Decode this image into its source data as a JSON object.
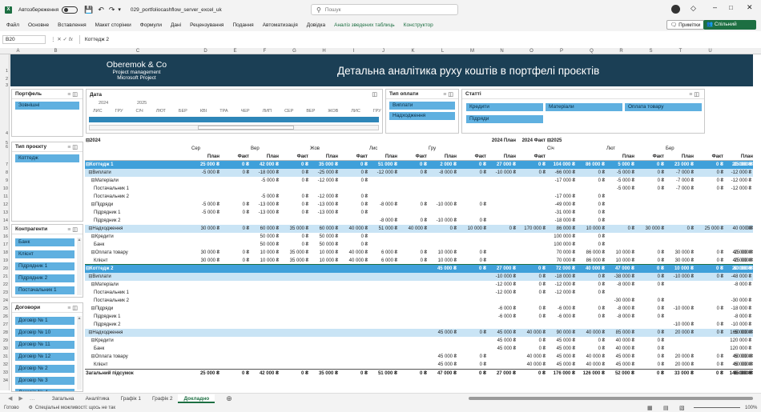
{
  "app": {
    "autosave_label": "Автозбереження",
    "file_name": "029_portfoliocashflow_server_excel_uk",
    "search_placeholder": "Пошук"
  },
  "menu": {
    "items": [
      "Файл",
      "Основне",
      "Вставлення",
      "Макет сторінки",
      "Формули",
      "Дані",
      "Рецензування",
      "Подання",
      "Автоматизація",
      "Довідка",
      "Аналіз зведених таблиць",
      "Конструктор"
    ],
    "notes": "Примітки",
    "share": "Спільний доступ"
  },
  "formula": {
    "cell_ref": "B20",
    "fx": "fx",
    "value": "Коттедж 2"
  },
  "columns": [
    "A",
    "B",
    "C",
    "D",
    "E",
    "F",
    "G",
    "H",
    "I",
    "J",
    "K",
    "L",
    "M",
    "N",
    "O",
    "P",
    "Q",
    "R",
    "S",
    "T",
    "U"
  ],
  "brand": {
    "name": "Oberemok & Co",
    "line1": "Project management",
    "line2": "Microsoft Project"
  },
  "report_title": "Детальна аналітика руху коштів в портфелі проєктів",
  "slicers": {
    "portfel": {
      "title": "Портфель",
      "items": [
        "Зовнішні"
      ]
    },
    "date": {
      "title": "Дата",
      "years": [
        "2024",
        "2025"
      ],
      "months": [
        "ЛИС",
        "ГРУ",
        "СІЧ",
        "ЛЮТ",
        "БЕР",
        "КВІ",
        "ТРА",
        "ЧЕР",
        "ЛИП",
        "СЕР",
        "ВЕР",
        "ЖОВ",
        "ЛИС",
        "ГРУ"
      ]
    },
    "pay_type": {
      "title": "Тип оплати",
      "items": [
        "Виплати",
        "Надходження"
      ]
    },
    "articles": {
      "title": "Статті",
      "items": [
        "Кредити",
        "Матеріали",
        "Оплата товару",
        "Підряди"
      ]
    },
    "project_type": {
      "title": "Тип проєкту",
      "items": [
        "Коттедж"
      ]
    },
    "contractors": {
      "title": "Контрагенти",
      "items": [
        "Банк",
        "Клієнт",
        "Підрядник 1",
        "Підрядник 2",
        "Постачальник 1"
      ]
    },
    "contracts": {
      "title": "Договори",
      "items": [
        "Договір № 1",
        "Договір № 10",
        "Договір № 11",
        "Договір № 12",
        "Договір № 2",
        "Договір № 3",
        "Договір № 4"
      ]
    }
  },
  "pivot": {
    "year_row": [
      "⊟2024",
      "2024 План",
      "2024 Факт",
      "⊟2025",
      "2025 План"
    ],
    "months": [
      "Сер",
      "Вер",
      "Жов",
      "Лис",
      "Гру",
      "Січ",
      "Лют",
      "Бер"
    ],
    "plan": "План",
    "fact": "Факт",
    "rows": [
      [
        "⊟Коттедж 1",
        "25 000 ₴",
        "0 ₴",
        "42 000 ₴",
        "0 ₴",
        "35 000 ₴",
        "0 ₴",
        "51 000 ₴",
        "0 ₴",
        "2 000 ₴",
        "0 ₴",
        "27 000 ₴",
        "0 ₴",
        "104 000 ₴",
        "86 000 ₴",
        "5 000 ₴",
        "0 ₴",
        "23 000 ₴",
        "0 ₴",
        "25 000 ₴",
        "0 ₴",
        "",
        "20 000 ₴"
      ],
      [
        "  ⊟Виплати",
        "-5 000 ₴",
        "0 ₴",
        "-18 000 ₴",
        "0 ₴",
        "-25 000 ₴",
        "0 ₴",
        "-12 000 ₴",
        "0 ₴",
        "-8 000 ₴",
        "0 ₴",
        "-10 000 ₴",
        "0 ₴",
        "-66 000 ₴",
        "0 ₴",
        "-5 000 ₴",
        "0 ₴",
        "-7 000 ₴",
        "0 ₴",
        "",
        "",
        "",
        "-12 000 ₴"
      ],
      [
        "    ⊟Матеріали",
        "",
        "",
        "-5 000 ₴",
        "0 ₴",
        "-12 000 ₴",
        "0 ₴",
        "",
        "",
        "",
        "",
        "",
        "",
        "-17 000 ₴",
        "0 ₴",
        "-5 000 ₴",
        "0 ₴",
        "-7 000 ₴",
        "0 ₴",
        "",
        "",
        "",
        "-12 000 ₴"
      ],
      [
        "      Постачальник 1",
        "",
        "",
        "",
        "",
        "",
        "",
        "",
        "",
        "",
        "",
        "",
        "",
        "",
        "",
        "-5 000 ₴",
        "0 ₴",
        "-7 000 ₴",
        "0 ₴",
        "",
        "",
        "",
        "-12 000 ₴"
      ],
      [
        "      Постачальник 2",
        "",
        "",
        "-5 000 ₴",
        "0 ₴",
        "-12 000 ₴",
        "0 ₴",
        "",
        "",
        "",
        "",
        "",
        "",
        "-17 000 ₴",
        "0 ₴",
        "",
        "",
        "",
        "",
        "",
        "",
        "",
        ""
      ],
      [
        "    ⊟Підряди",
        "-5 000 ₴",
        "0 ₴",
        "-13 000 ₴",
        "0 ₴",
        "-13 000 ₴",
        "0 ₴",
        "-8 000 ₴",
        "0 ₴",
        "-10 000 ₴",
        "0 ₴",
        "",
        "",
        "-49 000 ₴",
        "0 ₴",
        "",
        "",
        "",
        "",
        "",
        "",
        "",
        ""
      ],
      [
        "      Підрядник 1",
        "-5 000 ₴",
        "0 ₴",
        "-13 000 ₴",
        "0 ₴",
        "-13 000 ₴",
        "0 ₴",
        "",
        "",
        "",
        "",
        "",
        "",
        "-31 000 ₴",
        "0 ₴",
        "",
        "",
        "",
        "",
        "",
        "",
        "",
        ""
      ],
      [
        "      Підрядник 2",
        "",
        "",
        "",
        "",
        "",
        "",
        "-8 000 ₴",
        "0 ₴",
        "-10 000 ₴",
        "0 ₴",
        "",
        "",
        "-18 000 ₴",
        "0 ₴",
        "",
        "",
        "",
        "",
        "",
        "",
        "",
        ""
      ],
      [
        "  ⊟Надходження",
        "30 000 ₴",
        "0 ₴",
        "60 000 ₴",
        "35 000 ₴",
        "60 000 ₴",
        "40 000 ₴",
        "51 000 ₴",
        "40 000 ₴",
        "0 ₴",
        "10 000 ₴",
        "0 ₴",
        "170 000 ₴",
        "86 000 ₴",
        "10 000 ₴",
        "0 ₴",
        "30 000 ₴",
        "0 ₴",
        "25 000 ₴",
        "0 ₴",
        "",
        "",
        "40 000 ₴"
      ],
      [
        "    ⊟Кредити",
        "",
        "",
        "50 000 ₴",
        "0 ₴",
        "50 000 ₴",
        "0 ₴",
        "",
        "",
        "",
        "",
        "",
        "",
        "100 000 ₴",
        "0 ₴",
        "",
        "",
        "",
        "",
        "",
        "",
        "",
        ""
      ],
      [
        "      Банк",
        "",
        "",
        "50 000 ₴",
        "0 ₴",
        "50 000 ₴",
        "0 ₴",
        "",
        "",
        "",
        "",
        "",
        "",
        "100 000 ₴",
        "0 ₴",
        "",
        "",
        "",
        "",
        "",
        "",
        "",
        ""
      ],
      [
        "    ⊟Оплата товару",
        "30 000 ₴",
        "0 ₴",
        "10 000 ₴",
        "35 000 ₴",
        "10 000 ₴",
        "40 000 ₴",
        "6 000 ₴",
        "0 ₴",
        "10 000 ₴",
        "0 ₴",
        "",
        "",
        "70 000 ₴",
        "86 000 ₴",
        "10 000 ₴",
        "0 ₴",
        "30 000 ₴",
        "0 ₴",
        "25 000 ₴",
        "0 ₴",
        "",
        "40 000 ₴"
      ],
      [
        "      Клієнт",
        "30 000 ₴",
        "0 ₴",
        "10 000 ₴",
        "35 000 ₴",
        "10 000 ₴",
        "40 000 ₴",
        "6 000 ₴",
        "0 ₴",
        "10 000 ₴",
        "0 ₴",
        "",
        "",
        "70 000 ₴",
        "86 000 ₴",
        "10 000 ₴",
        "0 ₴",
        "30 000 ₴",
        "0 ₴",
        "25 000 ₴",
        "0 ₴",
        "",
        "40 000 ₴"
      ],
      [
        "⊟Коттедж 2",
        "",
        "",
        "",
        "",
        "",
        "",
        "",
        "",
        "45 000 ₴",
        "0 ₴",
        "27 000 ₴",
        "0 ₴",
        "72 000 ₴",
        "40 000 ₴",
        "47 000 ₴",
        "0 ₴",
        "10 000 ₴",
        "0 ₴",
        "60 000 ₴",
        "0 ₴",
        "",
        "20 000 ₴"
      ],
      [
        "  ⊟Виплати",
        "",
        "",
        "",
        "",
        "",
        "",
        "",
        "",
        "",
        "",
        "-10 000 ₴",
        "0 ₴",
        "-18 000 ₴",
        "0 ₴",
        "-38 000 ₴",
        "0 ₴",
        "-10 000 ₴",
        "0 ₴",
        "",
        "",
        "",
        "-48 000 ₴"
      ],
      [
        "    ⊟Матеріали",
        "",
        "",
        "",
        "",
        "",
        "",
        "",
        "",
        "",
        "",
        "-12 000 ₴",
        "0 ₴",
        "-12 000 ₴",
        "0 ₴",
        "-8 000 ₴",
        "0 ₴",
        "",
        "",
        "",
        "",
        "",
        "-8 000 ₴"
      ],
      [
        "      Постачальник 1",
        "",
        "",
        "",
        "",
        "",
        "",
        "",
        "",
        "",
        "",
        "-12 000 ₴",
        "0 ₴",
        "-12 000 ₴",
        "0 ₴",
        "",
        "",
        "",
        "",
        "",
        "",
        "",
        ""
      ],
      [
        "      Постачальник 2",
        "",
        "",
        "",
        "",
        "",
        "",
        "",
        "",
        "",
        "",
        "",
        "",
        "",
        "",
        "-30 000 ₴",
        "0 ₴",
        "",
        "",
        "",
        "",
        "",
        "-30 000 ₴"
      ],
      [
        "    ⊟Підряди",
        "",
        "",
        "",
        "",
        "",
        "",
        "",
        "",
        "",
        "",
        "-6 000 ₴",
        "0 ₴",
        "-6 000 ₴",
        "0 ₴",
        "-8 000 ₴",
        "0 ₴",
        "-10 000 ₴",
        "0 ₴",
        "",
        "",
        "",
        "-18 000 ₴"
      ],
      [
        "      Підрядник 1",
        "",
        "",
        "",
        "",
        "",
        "",
        "",
        "",
        "",
        "",
        "-6 000 ₴",
        "0 ₴",
        "-6 000 ₴",
        "0 ₴",
        "-8 000 ₴",
        "0 ₴",
        "",
        "",
        "",
        "",
        "",
        "-8 000 ₴"
      ],
      [
        "      Підрядник 2",
        "",
        "",
        "",
        "",
        "",
        "",
        "",
        "",
        "",
        "",
        "",
        "",
        "",
        "",
        "",
        "",
        "-10 000 ₴",
        "0 ₴",
        "",
        "",
        "",
        "-10 000 ₴"
      ],
      [
        "  ⊟Надходження",
        "",
        "",
        "",
        "",
        "",
        "",
        "",
        "",
        "45 000 ₴",
        "0 ₴",
        "45 000 ₴",
        "40 000 ₴",
        "90 000 ₴",
        "40 000 ₴",
        "85 000 ₴",
        "0 ₴",
        "20 000 ₴",
        "0 ₴",
        "60 000 ₴",
        "0 ₴",
        "",
        "165 000 ₴"
      ],
      [
        "    ⊟Кредити",
        "",
        "",
        "",
        "",
        "",
        "",
        "",
        "",
        "",
        "",
        "45 000 ₴",
        "0 ₴",
        "45 000 ₴",
        "0 ₴",
        "40 000 ₴",
        "0 ₴",
        "",
        "",
        "",
        "",
        "",
        "120 000 ₴"
      ],
      [
        "      Банк",
        "",
        "",
        "",
        "",
        "",
        "",
        "",
        "",
        "",
        "",
        "45 000 ₴",
        "0 ₴",
        "45 000 ₴",
        "0 ₴",
        "40 000 ₴",
        "0 ₴",
        "",
        "",
        "",
        "",
        "",
        "120 000 ₴"
      ],
      [
        "    ⊟Оплата товару",
        "",
        "",
        "",
        "",
        "",
        "",
        "",
        "",
        "45 000 ₴",
        "0 ₴",
        "",
        "40 000 ₴",
        "45 000 ₴",
        "40 000 ₴",
        "45 000 ₴",
        "0 ₴",
        "20 000 ₴",
        "0 ₴",
        "60 000 ₴",
        "0 ₴",
        "",
        "45 000 ₴"
      ],
      [
        "      Клієнт",
        "",
        "",
        "",
        "",
        "",
        "",
        "",
        "",
        "45 000 ₴",
        "0 ₴",
        "",
        "40 000 ₴",
        "45 000 ₴",
        "40 000 ₴",
        "45 000 ₴",
        "0 ₴",
        "20 000 ₴",
        "0 ₴",
        "60 000 ₴",
        "0 ₴",
        "",
        "45 000 ₴"
      ],
      [
        "Загальний підсумок",
        "25 000 ₴",
        "0 ₴",
        "42 000 ₴",
        "0 ₴",
        "35 000 ₴",
        "0 ₴",
        "51 000 ₴",
        "0 ₴",
        "47 000 ₴",
        "0 ₴",
        "27 000 ₴",
        "0 ₴",
        "176 000 ₴",
        "126 000 ₴",
        "52 000 ₴",
        "0 ₴",
        "33 000 ₴",
        "0 ₴",
        "85 000 ₴",
        "0 ₴",
        "",
        "145 000 ₴"
      ]
    ]
  },
  "sheets": [
    "Загальна",
    "Аналітика",
    "Графік 1",
    "Графік 2",
    "Докладно"
  ],
  "active_sheet": "Докладно",
  "status": {
    "ready": "Готово",
    "accessibility": "Спеціальні можливості: щось не так",
    "zoom": "100%"
  }
}
